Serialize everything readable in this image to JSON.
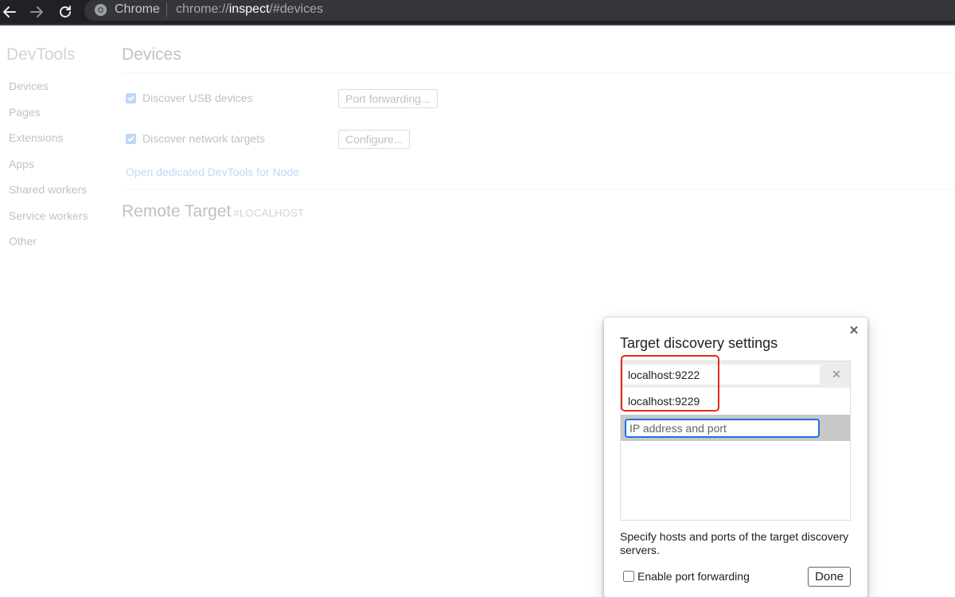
{
  "browser": {
    "app_name": "Chrome",
    "url_prefix": "chrome://",
    "url_highlight": "inspect",
    "url_suffix": "/#devices",
    "icons": {
      "back": "arrow-left-icon",
      "forward": "arrow-right-icon",
      "reload": "reload-icon",
      "site": "chrome-icon"
    }
  },
  "sidebar": {
    "title": "DevTools",
    "items": [
      {
        "label": "Devices"
      },
      {
        "label": "Pages"
      },
      {
        "label": "Extensions"
      },
      {
        "label": "Apps"
      },
      {
        "label": "Shared workers"
      },
      {
        "label": "Service workers"
      },
      {
        "label": "Other"
      }
    ]
  },
  "devices": {
    "title": "Devices",
    "usb_label": "Discover USB devices",
    "usb_checked": true,
    "port_forwarding_button": "Port forwarding...",
    "network_label": "Discover network targets",
    "network_checked": true,
    "configure_button": "Configure...",
    "node_link": "Open dedicated DevTools for Node"
  },
  "remote_target": {
    "title": "Remote Target",
    "subtitle": "#LOCALHOST"
  },
  "dialog": {
    "title": "Target discovery settings",
    "close_icon": "close-icon",
    "targets": [
      {
        "value": "localhost:9222"
      },
      {
        "value": "localhost:9229"
      }
    ],
    "new_target_placeholder": "IP address and port",
    "help_text": "Specify hosts and ports of the target discovery servers.",
    "enable_port_forwarding_label": "Enable port forwarding",
    "enable_port_forwarding_checked": false,
    "done_button": "Done"
  },
  "colors": {
    "accent": "#1a73e8",
    "annotation_highlight": "#e22c1c",
    "toolbar_bg": "#202124"
  }
}
